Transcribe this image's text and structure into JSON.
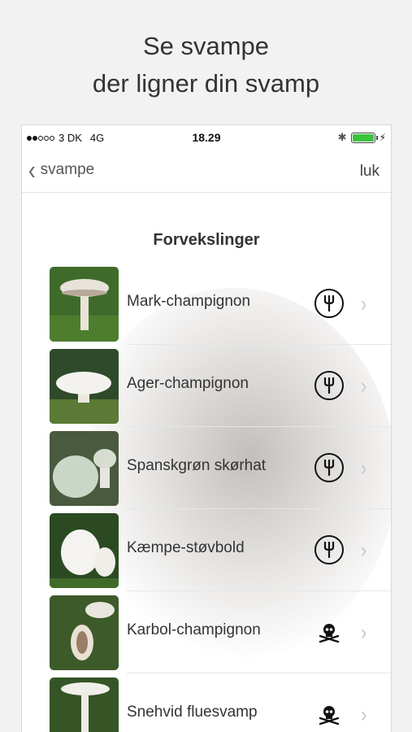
{
  "headline": {
    "line1": "Se svampe",
    "line2": "der ligner din svamp"
  },
  "status_bar": {
    "carrier": "3 DK",
    "network": "4G",
    "time": "18.29"
  },
  "nav": {
    "back_label": "svampe",
    "close_label": "luk"
  },
  "section_title": "Forvekslinger",
  "items": [
    {
      "name": "Mark-champignon",
      "status_icon": "edible-fork-icon"
    },
    {
      "name": "Ager-champignon",
      "status_icon": "edible-fork-icon"
    },
    {
      "name": "Spanskgrøn skørhat",
      "status_icon": "edible-fork-icon"
    },
    {
      "name": "Kæmpe-støvbold",
      "status_icon": "edible-fork-icon"
    },
    {
      "name": "Karbol-champignon",
      "status_icon": "poison-skull-icon"
    },
    {
      "name": "Snehvid fluesvamp",
      "status_icon": "poison-skull-icon"
    }
  ],
  "colors": {
    "battery": "#3cc33c",
    "background": "#f2f2f2"
  }
}
